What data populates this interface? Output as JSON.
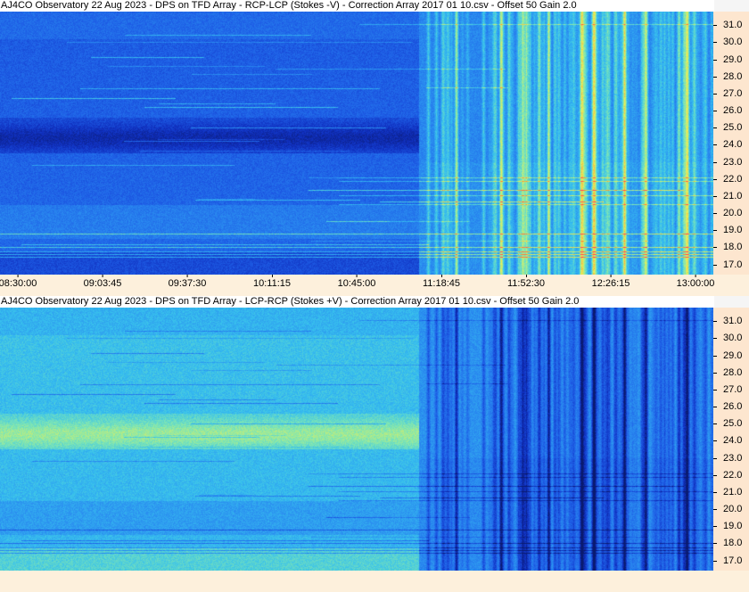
{
  "panels": [
    {
      "title": "AJ4CO Observatory 22 Aug 2023 -  DPS on TFD Array  -  RCP-LCP (Stokes -V)  -  Correction Array 2017 01 10.csv  -  Offset 50  Gain 2.0",
      "polarity": "rcp-lcp"
    },
    {
      "title": "AJ4CO Observatory 22 Aug 2023 -  DPS on TFD Array  -  LCP-RCP (Stokes +V)  -  Correction Array 2017 01 10.csv  -  Offset 50  Gain 2.0",
      "polarity": "lcp-rcp"
    }
  ],
  "chart_data": {
    "type": "heatmap",
    "x_label_ticks": [
      "08:30:00",
      "09:03:45",
      "09:37:30",
      "10:11:15",
      "10:45:00",
      "11:18:45",
      "11:52:30",
      "12:26:15",
      "13:00:00"
    ],
    "y_ticks": [
      "31.0",
      "30.0",
      "29.0",
      "28.0",
      "27.0",
      "26.0",
      "25.0",
      "24.0",
      "23.0",
      "22.0",
      "21.0",
      "20.0",
      "19.0",
      "18.0",
      "17.0"
    ],
    "y_tick_values": [
      31,
      30,
      29,
      28,
      27,
      26,
      25,
      24,
      23,
      22,
      21,
      20,
      19,
      18,
      17
    ],
    "ylim": [
      16.4,
      31.8
    ],
    "x_time_range": [
      "08:30:00",
      "13:00:00"
    ],
    "x_time_change": "11:08:30",
    "colormap": [
      "#0a1a6e",
      "#1030c0",
      "#1e5ee6",
      "#2a8cf0",
      "#37c0ee",
      "#7ee6b4",
      "#e6f05a",
      "#ff8c32",
      "#ff3c64"
    ]
  }
}
